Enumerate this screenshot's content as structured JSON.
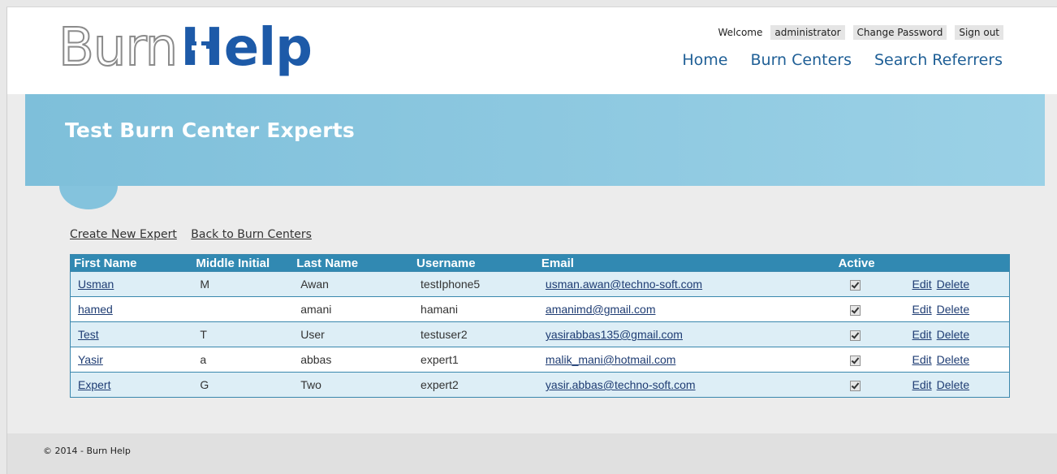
{
  "brand": {
    "logo_light": "Burn",
    "logo_h": "H",
    "logo_rest": "elp"
  },
  "userbar": {
    "welcome": "Welcome",
    "username": "administrator",
    "change_password": "Change Password",
    "sign_out": "Sign out"
  },
  "nav": {
    "home": "Home",
    "burn_centers": "Burn Centers",
    "search_referrers": "Search Referrers"
  },
  "page_title": "Test Burn Center Experts",
  "actions": {
    "create_new": "Create New Expert",
    "back": "Back to Burn Centers"
  },
  "table": {
    "headers": {
      "first_name": "First Name",
      "middle_initial": "Middle Initial",
      "last_name": "Last Name",
      "username": "Username",
      "email": "Email",
      "active": "Active"
    },
    "rows": [
      {
        "first": "Usman",
        "mi": "M",
        "last": "Awan",
        "username": "testIphone5",
        "email": "usman.awan@techno-soft.com",
        "active": true
      },
      {
        "first": "hamed",
        "mi": "",
        "last": "amani",
        "username": "hamani",
        "email": "amanimd@gmail.com",
        "active": true
      },
      {
        "first": "Test",
        "mi": "T",
        "last": "User",
        "username": "testuser2",
        "email": "yasirabbas135@gmail.com",
        "active": true
      },
      {
        "first": "Yasir",
        "mi": "a",
        "last": "abbas",
        "username": "expert1",
        "email": "malik_mani@hotmail.com",
        "active": true
      },
      {
        "first": "Expert",
        "mi": "G",
        "last": "Two",
        "username": "expert2",
        "email": "yasir.abbas@techno-soft.com",
        "active": true
      }
    ],
    "edit_label": "Edit",
    "delete_label": "Delete"
  },
  "footer": "© 2014 - Burn Help",
  "colors": {
    "accent": "#3189b2",
    "brand_blue": "#1d5aa8",
    "banner": "#8ccbe3"
  }
}
